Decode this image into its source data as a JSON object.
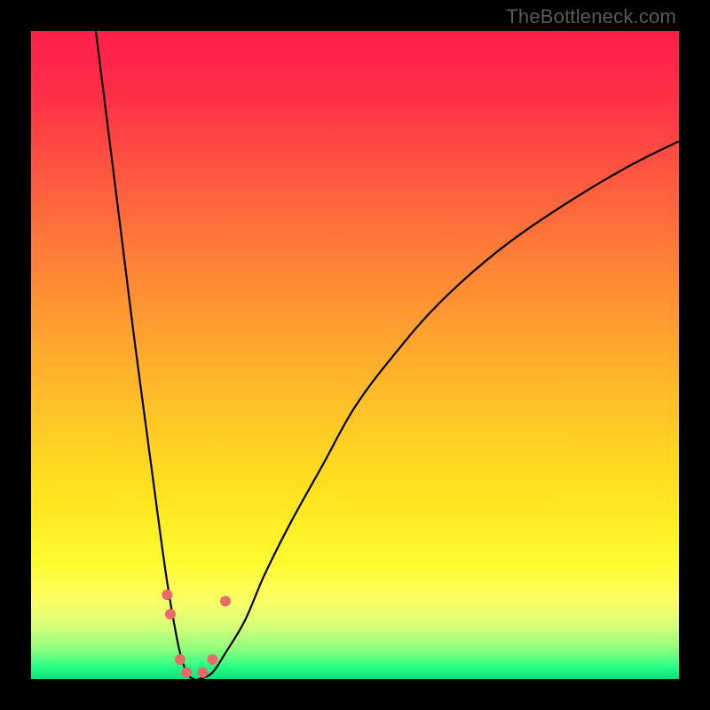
{
  "watermark": "TheBottleneck.com",
  "gradient_stops": [
    {
      "offset": 0.0,
      "color": "#ff1f4a"
    },
    {
      "offset": 0.1,
      "color": "#ff2f47"
    },
    {
      "offset": 0.22,
      "color": "#ff5740"
    },
    {
      "offset": 0.35,
      "color": "#ff7f37"
    },
    {
      "offset": 0.48,
      "color": "#ffa52e"
    },
    {
      "offset": 0.6,
      "color": "#ffc726"
    },
    {
      "offset": 0.72,
      "color": "#ffe51f"
    },
    {
      "offset": 0.82,
      "color": "#fffb30"
    },
    {
      "offset": 0.88,
      "color": "#faff66"
    },
    {
      "offset": 0.92,
      "color": "#d4ff7a"
    },
    {
      "offset": 0.955,
      "color": "#8dff7d"
    },
    {
      "offset": 0.98,
      "color": "#2cff86"
    },
    {
      "offset": 1.0,
      "color": "#00e67a"
    }
  ],
  "marker_color": "#e86a69",
  "chart_data": {
    "type": "line",
    "title": "",
    "xlabel": "",
    "ylabel": "",
    "xlim": [
      0,
      100
    ],
    "ylim": [
      0,
      100
    ],
    "series": [
      {
        "name": "bottleneck-curve",
        "x": [
          10,
          12,
          14,
          16,
          18,
          20,
          21,
          22,
          23,
          24,
          25,
          26,
          28,
          30,
          33,
          36,
          40,
          45,
          50,
          56,
          63,
          72,
          82,
          92,
          100
        ],
        "y": [
          100,
          84,
          68,
          52,
          37,
          22,
          15,
          9,
          4,
          1,
          0,
          0,
          1,
          4,
          9,
          16,
          24,
          33,
          42,
          50,
          58,
          66,
          73,
          79,
          83
        ]
      }
    ],
    "markers": [
      {
        "x": 21.0,
        "y": 13.0
      },
      {
        "x": 21.5,
        "y": 10.0
      },
      {
        "x": 23.0,
        "y": 3.0
      },
      {
        "x": 24.0,
        "y": 1.0
      },
      {
        "x": 26.5,
        "y": 1.0
      },
      {
        "x": 28.0,
        "y": 3.0
      },
      {
        "x": 30.0,
        "y": 12.0
      }
    ]
  }
}
